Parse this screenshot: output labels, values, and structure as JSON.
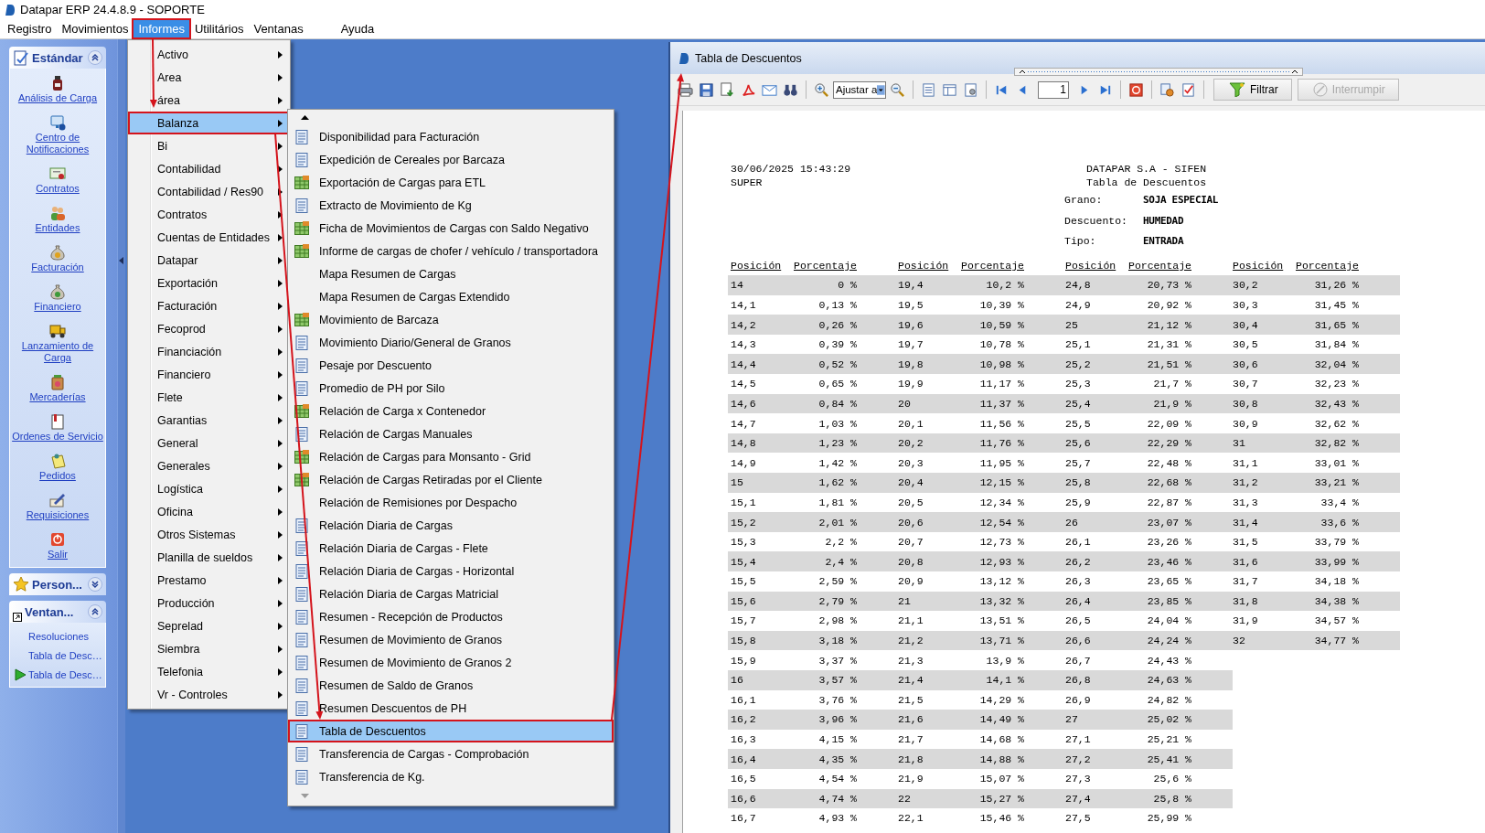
{
  "window": {
    "title": "Datapar ERP 24.4.8.9 - SOPORTE"
  },
  "menu_bar": [
    {
      "label": "Registro",
      "selected": false
    },
    {
      "label": "Movimientos",
      "selected": false
    },
    {
      "label": "Informes",
      "selected": true
    },
    {
      "label": "Utilitários",
      "selected": false
    },
    {
      "label": "Ventanas",
      "selected": false
    },
    {
      "label": "Ayuda",
      "selected": false
    }
  ],
  "sidebar": {
    "panels": [
      {
        "title": "Estándar",
        "expanded": true,
        "items": [
          {
            "label": "Análisis de Carga"
          },
          {
            "label": "Centro de Notificaciones"
          },
          {
            "label": "Contratos"
          },
          {
            "label": "Entidades"
          },
          {
            "label": "Facturación"
          },
          {
            "label": "Financiero"
          },
          {
            "label": "Lanzamiento de Carga"
          },
          {
            "label": "Mercaderías"
          },
          {
            "label": "Ordenes de Servicio"
          },
          {
            "label": "Pedidos"
          },
          {
            "label": "Requisiciones"
          },
          {
            "label": "Salir"
          }
        ]
      },
      {
        "title": "Person...",
        "expanded": false
      },
      {
        "title": "Ventan...",
        "expanded": true,
        "windows": [
          {
            "label": "Resoluciones",
            "active": false
          },
          {
            "label": "Tabla de Desc…",
            "active": false
          },
          {
            "label": "Tabla de Desc…",
            "active": true
          }
        ]
      }
    ]
  },
  "informes_menu": {
    "items": [
      {
        "label": "Activo",
        "selected": false,
        "has_submenu": true
      },
      {
        "label": "Area",
        "selected": false,
        "has_submenu": true
      },
      {
        "label": "área",
        "selected": false,
        "has_submenu": true
      },
      {
        "label": "Balanza",
        "selected": true,
        "has_submenu": true
      },
      {
        "label": "Bi",
        "selected": false,
        "has_submenu": true
      },
      {
        "label": "Contabilidad",
        "selected": false,
        "has_submenu": true
      },
      {
        "label": "Contabilidad / Res90",
        "selected": false,
        "has_submenu": true
      },
      {
        "label": "Contratos",
        "selected": false,
        "has_submenu": true
      },
      {
        "label": "Cuentas de Entidades",
        "selected": false,
        "has_submenu": true
      },
      {
        "label": "Datapar",
        "selected": false,
        "has_submenu": true
      },
      {
        "label": "Exportación",
        "selected": false,
        "has_submenu": true
      },
      {
        "label": "Facturación",
        "selected": false,
        "has_submenu": true
      },
      {
        "label": "Fecoprod",
        "selected": false,
        "has_submenu": true
      },
      {
        "label": "Financiación",
        "selected": false,
        "has_submenu": true
      },
      {
        "label": "Financiero",
        "selected": false,
        "has_submenu": true
      },
      {
        "label": "Flete",
        "selected": false,
        "has_submenu": true
      },
      {
        "label": "Garantias",
        "selected": false,
        "has_submenu": true
      },
      {
        "label": "General",
        "selected": false,
        "has_submenu": true
      },
      {
        "label": "Generales",
        "selected": false,
        "has_submenu": true
      },
      {
        "label": "Logística",
        "selected": false,
        "has_submenu": true
      },
      {
        "label": "Oficina",
        "selected": false,
        "has_submenu": true
      },
      {
        "label": "Otros Sistemas",
        "selected": false,
        "has_submenu": true
      },
      {
        "label": "Planilla de sueldos",
        "selected": false,
        "has_submenu": true
      },
      {
        "label": "Prestamo",
        "selected": false,
        "has_submenu": true
      },
      {
        "label": "Producción",
        "selected": false,
        "has_submenu": true
      },
      {
        "label": "Seprelad",
        "selected": false,
        "has_submenu": true
      },
      {
        "label": "Siembra",
        "selected": false,
        "has_submenu": true
      },
      {
        "label": "Telefonia",
        "selected": false,
        "has_submenu": true
      },
      {
        "label": "Vr - Controles",
        "selected": false,
        "has_submenu": true
      }
    ]
  },
  "balanza_submenu": {
    "items": [
      {
        "label": "Disponibilidad para Facturación",
        "kind": "report",
        "selected": false
      },
      {
        "label": "Expedición de Cereales por Barcaza",
        "kind": "report",
        "selected": false
      },
      {
        "label": "Exportación de Cargas para ETL",
        "kind": "grid",
        "selected": false
      },
      {
        "label": "Extracto de Movimiento de Kg",
        "kind": "report",
        "selected": false
      },
      {
        "label": "Ficha de Movimientos de Cargas con Saldo Negativo",
        "kind": "grid",
        "selected": false
      },
      {
        "label": "Informe de cargas de chofer / vehículo / transportadora",
        "kind": "grid",
        "selected": false
      },
      {
        "label": "Mapa Resumen de Cargas",
        "kind": "plain",
        "selected": false
      },
      {
        "label": "Mapa Resumen de Cargas Extendido",
        "kind": "plain",
        "selected": false
      },
      {
        "label": "Movimiento de Barcaza",
        "kind": "grid",
        "selected": false
      },
      {
        "label": "Movimiento Diario/General de Granos",
        "kind": "report",
        "selected": false
      },
      {
        "label": "Pesaje por Descuento",
        "kind": "report",
        "selected": false
      },
      {
        "label": "Promedio de PH por Silo",
        "kind": "report",
        "selected": false
      },
      {
        "label": "Relación de Carga x Contenedor",
        "kind": "grid",
        "selected": false
      },
      {
        "label": "Relación de Cargas Manuales",
        "kind": "report",
        "selected": false
      },
      {
        "label": "Relación de Cargas para Monsanto - Grid",
        "kind": "grid",
        "selected": false
      },
      {
        "label": "Relación de Cargas Retiradas por el Cliente",
        "kind": "grid",
        "selected": false
      },
      {
        "label": "Relación de Remisiones por Despacho",
        "kind": "plain",
        "selected": false
      },
      {
        "label": "Relación Diaria de Cargas",
        "kind": "report",
        "selected": false
      },
      {
        "label": "Relación Diaria de Cargas - Flete",
        "kind": "report",
        "selected": false
      },
      {
        "label": "Relación Diaria de Cargas - Horizontal",
        "kind": "report",
        "selected": false
      },
      {
        "label": "Relación Diaria de Cargas Matricial",
        "kind": "report",
        "selected": false
      },
      {
        "label": "Resumen - Recepción de Productos",
        "kind": "report",
        "selected": false
      },
      {
        "label": "Resumen de Movimiento de Granos",
        "kind": "report",
        "selected": false
      },
      {
        "label": "Resumen de Movimiento de Granos 2",
        "kind": "report",
        "selected": false
      },
      {
        "label": "Resumen de Saldo de Granos",
        "kind": "report",
        "selected": false
      },
      {
        "label": "Resumen Descuentos de PH",
        "kind": "report",
        "selected": false
      },
      {
        "label": "Tabla de Descuentos",
        "kind": "report",
        "selected": true
      },
      {
        "label": "Transferencia de Cargas - Comprobación",
        "kind": "report",
        "selected": false
      },
      {
        "label": "Transferencia de Kg.",
        "kind": "report",
        "selected": false
      }
    ]
  },
  "report_window": {
    "title": "Tabla de Descuentos",
    "toolbar": {
      "zoom": "Ajustar a",
      "page": "1",
      "filter_button": "Filtrar",
      "stop_button": {
        "label": "Interrumpir",
        "disabled": true
      }
    },
    "report": {
      "printed_at": "30/06/2025 15:43:29",
      "user": "SUPER",
      "company": "DATAPAR S.A - SIFEN",
      "title": "Tabla de Descuentos",
      "fields": [
        {
          "label": "Grano:",
          "value": "SOJA ESPECIAL"
        },
        {
          "label": "Descuento:",
          "value": "HUMEDAD"
        },
        {
          "label": "Tipo:",
          "value": "ENTRADA"
        }
      ],
      "table": {
        "columns": [
          "Posición",
          "Porcentaje",
          "Posición",
          "Porcentaje",
          "Posición",
          "Porcentaje",
          "Posición",
          "Porcentaje"
        ],
        "rows": [
          [
            "14",
            "0 %",
            "19,4",
            "10,2 %",
            "24,8",
            "20,73 %",
            "30,2",
            "31,26 %"
          ],
          [
            "14,1",
            "0,13 %",
            "19,5",
            "10,39 %",
            "24,9",
            "20,92 %",
            "30,3",
            "31,45 %"
          ],
          [
            "14,2",
            "0,26 %",
            "19,6",
            "10,59 %",
            "25",
            "21,12 %",
            "30,4",
            "31,65 %"
          ],
          [
            "14,3",
            "0,39 %",
            "19,7",
            "10,78 %",
            "25,1",
            "21,31 %",
            "30,5",
            "31,84 %"
          ],
          [
            "14,4",
            "0,52 %",
            "19,8",
            "10,98 %",
            "25,2",
            "21,51 %",
            "30,6",
            "32,04 %"
          ],
          [
            "14,5",
            "0,65 %",
            "19,9",
            "11,17 %",
            "25,3",
            "21,7 %",
            "30,7",
            "32,23 %"
          ],
          [
            "14,6",
            "0,84 %",
            "20",
            "11,37 %",
            "25,4",
            "21,9 %",
            "30,8",
            "32,43 %"
          ],
          [
            "14,7",
            "1,03 %",
            "20,1",
            "11,56 %",
            "25,5",
            "22,09 %",
            "30,9",
            "32,62 %"
          ],
          [
            "14,8",
            "1,23 %",
            "20,2",
            "11,76 %",
            "25,6",
            "22,29 %",
            "31",
            "32,82 %"
          ],
          [
            "14,9",
            "1,42 %",
            "20,3",
            "11,95 %",
            "25,7",
            "22,48 %",
            "31,1",
            "33,01 %"
          ],
          [
            "15",
            "1,62 %",
            "20,4",
            "12,15 %",
            "25,8",
            "22,68 %",
            "31,2",
            "33,21 %"
          ],
          [
            "15,1",
            "1,81 %",
            "20,5",
            "12,34 %",
            "25,9",
            "22,87 %",
            "31,3",
            "33,4 %"
          ],
          [
            "15,2",
            "2,01 %",
            "20,6",
            "12,54 %",
            "26",
            "23,07 %",
            "31,4",
            "33,6 %"
          ],
          [
            "15,3",
            "2,2 %",
            "20,7",
            "12,73 %",
            "26,1",
            "23,26 %",
            "31,5",
            "33,79 %"
          ],
          [
            "15,4",
            "2,4 %",
            "20,8",
            "12,93 %",
            "26,2",
            "23,46 %",
            "31,6",
            "33,99 %"
          ],
          [
            "15,5",
            "2,59 %",
            "20,9",
            "13,12 %",
            "26,3",
            "23,65 %",
            "31,7",
            "34,18 %"
          ],
          [
            "15,6",
            "2,79 %",
            "21",
            "13,32 %",
            "26,4",
            "23,85 %",
            "31,8",
            "34,38 %"
          ],
          [
            "15,7",
            "2,98 %",
            "21,1",
            "13,51 %",
            "26,5",
            "24,04 %",
            "31,9",
            "34,57 %"
          ],
          [
            "15,8",
            "3,18 %",
            "21,2",
            "13,71 %",
            "26,6",
            "24,24 %",
            "32",
            "34,77 %"
          ],
          [
            "15,9",
            "3,37 %",
            "21,3",
            "13,9 %",
            "26,7",
            "24,43 %"
          ],
          [
            "16",
            "3,57 %",
            "21,4",
            "14,1 %",
            "26,8",
            "24,63 %"
          ],
          [
            "16,1",
            "3,76 %",
            "21,5",
            "14,29 %",
            "26,9",
            "24,82 %"
          ],
          [
            "16,2",
            "3,96 %",
            "21,6",
            "14,49 %",
            "27",
            "25,02 %"
          ],
          [
            "16,3",
            "4,15 %",
            "21,7",
            "14,68 %",
            "27,1",
            "25,21 %"
          ],
          [
            "16,4",
            "4,35 %",
            "21,8",
            "14,88 %",
            "27,2",
            "25,41 %"
          ],
          [
            "16,5",
            "4,54 %",
            "21,9",
            "15,07 %",
            "27,3",
            "25,6 %"
          ],
          [
            "16,6",
            "4,74 %",
            "22",
            "15,27 %",
            "27,4",
            "25,8 %"
          ],
          [
            "16,7",
            "4,93 %",
            "22,1",
            "15,46 %",
            "27,5",
            "25,99 %"
          ]
        ]
      }
    }
  }
}
